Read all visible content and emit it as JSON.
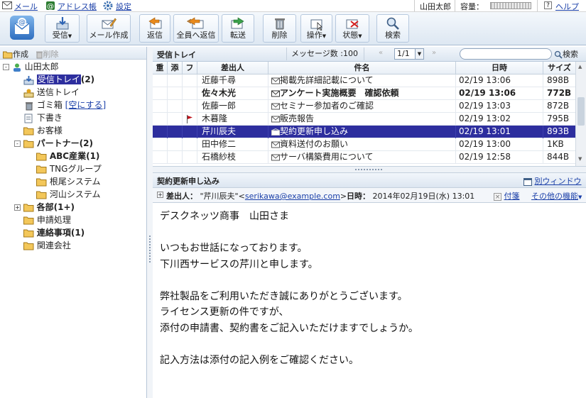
{
  "topbar": {
    "mail": "メール",
    "address_book": "アドレス帳",
    "settings": "設定",
    "user": "山田太郎",
    "capacity_label": "容量：",
    "help": "ヘルプ"
  },
  "toolbar": {
    "receive": "受信",
    "compose": "メール作成",
    "reply": "返信",
    "reply_all": "全員へ返信",
    "forward": "転送",
    "delete": "削除",
    "operation": "操作",
    "status": "状態",
    "search": "検索"
  },
  "left": {
    "create": "作成",
    "delete": "削除",
    "root": "山田太郎",
    "folders": [
      {
        "label": "受信トレイ",
        "count": "(2)"
      },
      {
        "label": "送信トレイ",
        "count": ""
      },
      {
        "label": "ゴミ箱",
        "count": "",
        "action": "[空にする]"
      },
      {
        "label": "下書き",
        "count": ""
      },
      {
        "label": "お客様",
        "count": ""
      },
      {
        "label": "パートナー",
        "count": "(2)"
      },
      {
        "label": "ABC産業",
        "count": "(1)"
      },
      {
        "label": "TNGグループ",
        "count": ""
      },
      {
        "label": "根尾システム",
        "count": ""
      },
      {
        "label": "河山システム",
        "count": ""
      },
      {
        "label": "各部",
        "count": "(1+)"
      },
      {
        "label": "申請処理",
        "count": ""
      },
      {
        "label": "連絡事項",
        "count": "(1)"
      },
      {
        "label": "関連会社",
        "count": ""
      }
    ],
    "toggles": {
      "root": "-",
      "partner": "-",
      "dept": "+"
    }
  },
  "list": {
    "title": "受信トレイ",
    "message_count": "メッセージ数 :100",
    "page": "1/1",
    "search_label": "検索",
    "columns": [
      "重",
      "添",
      "フ",
      "差出人",
      "件名",
      "日時",
      "サイズ"
    ],
    "rows": [
      {
        "flag": "",
        "from": "近藤千尋",
        "subject": "掲載先詳細記載について",
        "date": "02/19 13:06",
        "size": "898B",
        "bold": false,
        "selected": false
      },
      {
        "flag": "",
        "from": "佐々木光",
        "subject": "アンケート実施概要　確認依頼",
        "date": "02/19 13:06",
        "size": "772B",
        "bold": true,
        "selected": false
      },
      {
        "flag": "",
        "from": "佐藤一郎",
        "subject": "セミナー参加者のご確認",
        "date": "02/19 13:03",
        "size": "872B",
        "bold": false,
        "selected": false
      },
      {
        "flag": "red-flag",
        "from": "木暮隆",
        "subject": "販売報告",
        "date": "02/19 13:02",
        "size": "795B",
        "bold": false,
        "selected": false
      },
      {
        "flag": "",
        "from": "芹川辰夫",
        "subject": "契約更新申し込み",
        "date": "02/19 13:01",
        "size": "893B",
        "bold": false,
        "selected": true
      },
      {
        "flag": "",
        "from": "田中修二",
        "subject": "資料送付のお願い",
        "date": "02/19 13:00",
        "size": "1KB",
        "bold": false,
        "selected": false
      },
      {
        "flag": "",
        "from": "石橋紗枝",
        "subject": "サーバ構築費用について",
        "date": "02/19 12:58",
        "size": "844B",
        "bold": false,
        "selected": false
      }
    ]
  },
  "preview": {
    "title": "契約更新申し込み",
    "new_window": "別ウィンドウ",
    "from_label": "差出人：",
    "from_name": "\"芹川辰夫\"<",
    "from_email": "serikawa@example.com",
    "from_close": ">",
    "date_label": "日時：",
    "date_value": "2014年02月19日(水) 13:01",
    "sticky": "付箋",
    "other": "その他の機能",
    "body": [
      "デスクネッツ商事　山田さま",
      "",
      "いつもお世話になっております。",
      "下川西サービスの芹川と申します。",
      "",
      "弊社製品をご利用いただき誠にありがとうございます。",
      "ライセンス更新の件ですが、",
      "添付の申請書、契約書をご記入いただけますでしょうか。",
      "",
      "記入方法は添付の記入例をご確認ください。"
    ]
  },
  "colors": {
    "selected_row": "#2d2e9e",
    "link": "#1a3fa8",
    "flag": "#c0121b"
  }
}
